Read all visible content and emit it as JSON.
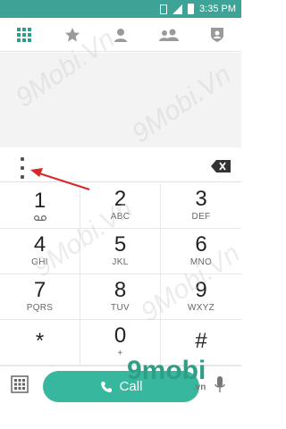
{
  "status": {
    "time": "3:35 PM"
  },
  "tabs": [
    {
      "name": "tab-dialpad",
      "icon": "grid-icon"
    },
    {
      "name": "tab-favorites",
      "icon": "star-icon"
    },
    {
      "name": "tab-contacts",
      "icon": "person-icon"
    },
    {
      "name": "tab-groups",
      "icon": "group-icon"
    },
    {
      "name": "tab-block",
      "icon": "shield-person-icon"
    }
  ],
  "keypad": [
    {
      "digit": "1",
      "letters": ""
    },
    {
      "digit": "2",
      "letters": "ABC"
    },
    {
      "digit": "3",
      "letters": "DEF"
    },
    {
      "digit": "4",
      "letters": "GHI"
    },
    {
      "digit": "5",
      "letters": "JKL"
    },
    {
      "digit": "6",
      "letters": "MNO"
    },
    {
      "digit": "7",
      "letters": "PQRS"
    },
    {
      "digit": "8",
      "letters": "TUV"
    },
    {
      "digit": "9",
      "letters": "WXYZ"
    },
    {
      "digit": "*",
      "letters": ""
    },
    {
      "digit": "0",
      "letters": "+"
    },
    {
      "digit": "#",
      "letters": ""
    }
  ],
  "call": {
    "label": "Call"
  },
  "watermark": {
    "text": "9Mobi.Vn",
    "logo": "9mobi",
    "logo_suffix": ".vn"
  },
  "colors": {
    "accent": "#37b79d",
    "status_bar": "#3da396",
    "arrow": "#d9262b"
  }
}
